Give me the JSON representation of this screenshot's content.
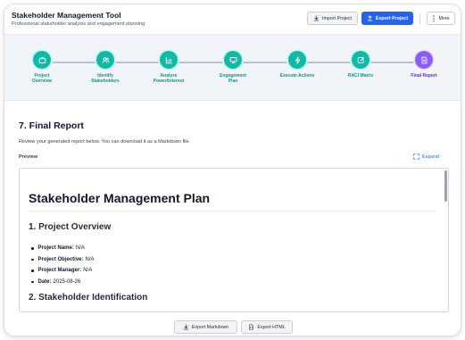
{
  "header": {
    "title": "Stakeholder Management Tool",
    "subtitle": "Professional stakeholder analysis and engagement planning",
    "import_label": "Import Project",
    "export_label": "Export Project",
    "more_label": "More"
  },
  "steps": [
    {
      "label": "Project\nOverview",
      "icon": "briefcase-icon",
      "state": "done"
    },
    {
      "label": "Identify\nStakeholders",
      "icon": "users-icon",
      "state": "done"
    },
    {
      "label": "Analyze\nPower/Interest",
      "icon": "chart-icon",
      "state": "done"
    },
    {
      "label": "Engagement\nPlan",
      "icon": "monitor-icon",
      "state": "done"
    },
    {
      "label": "Execute Actions",
      "icon": "lightning-icon",
      "state": "done"
    },
    {
      "label": "RACI Matrix",
      "icon": "edit-icon",
      "state": "done"
    },
    {
      "label": "Final Report",
      "icon": "document-icon",
      "state": "active"
    }
  ],
  "main": {
    "title": "7. Final Report",
    "description": "Review your generated report below. You can download it as a Markdown file.",
    "preview_label": "Preview",
    "expand_label": "Expand"
  },
  "report": {
    "h1": "Stakeholder Management Plan",
    "section1": "1. Project Overview",
    "fields": [
      {
        "key": "Project Name:",
        "value": "N/A"
      },
      {
        "key": "Project Objective:",
        "value": "N/A"
      },
      {
        "key": "Project Manager:",
        "value": "N/A"
      },
      {
        "key": "Date:",
        "value": "2025-08-26"
      }
    ],
    "section2": "2. Stakeholder Identification"
  },
  "actions": {
    "export_markdown": "Export Markdown",
    "export_html": "Export HTML"
  },
  "colors": {
    "accent": "#2563eb",
    "step_done": "#14b8a6",
    "step_active": "#8b5cf6"
  }
}
